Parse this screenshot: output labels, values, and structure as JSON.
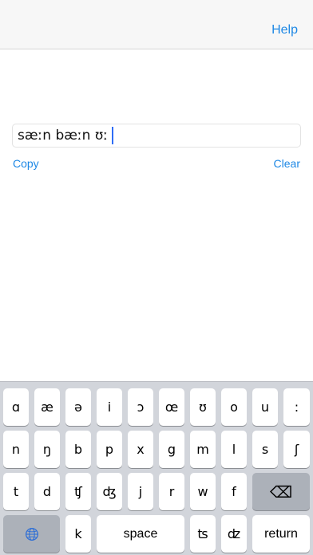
{
  "navbar": {
    "help_label": "Help"
  },
  "editor": {
    "text": "sæːn bæːn ʊː"
  },
  "actions": {
    "copy_label": "Copy",
    "clear_label": "Clear"
  },
  "keyboard": {
    "row1": [
      "ɑ",
      "æ",
      "ə",
      "i",
      "ɔ",
      "œ",
      "ʊ",
      "o",
      "u",
      ":"
    ],
    "row2": [
      "n",
      "ŋ",
      "b",
      "p",
      "x",
      "g",
      "m",
      "l",
      "s",
      "ʃ"
    ],
    "row3": [
      "t",
      "d",
      "ʧ",
      "ʤ",
      "j",
      "r",
      "w",
      "f"
    ],
    "delete_symbol": "⌫",
    "row4": {
      "k": "k",
      "space_label": "space",
      "ts": "ʦ",
      "dz": "ʣ",
      "return_label": "return"
    },
    "globe_icon": "globe-icon",
    "colors": {
      "key_bg": "#ffffff",
      "keyboard_bg": "#d2d5db",
      "accent": "#1e88e5",
      "caret": "#2f6df6"
    }
  }
}
